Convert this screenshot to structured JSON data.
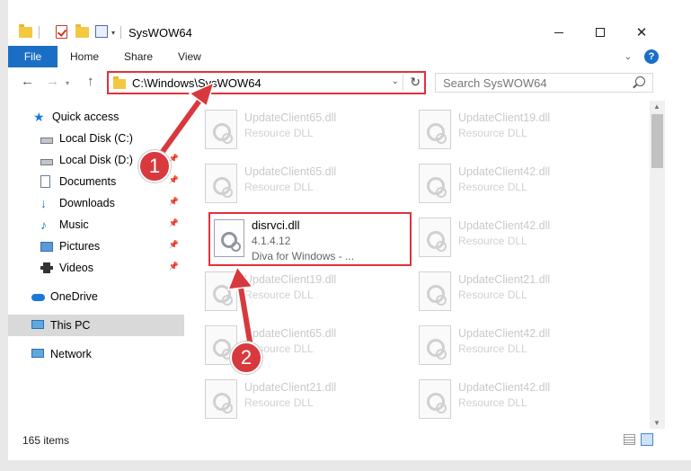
{
  "window": {
    "title": "SysWOW64",
    "controls": {
      "minimize": "minimize",
      "maximize": "maximize",
      "close": "✕"
    }
  },
  "ribbon": {
    "tabs": [
      "File",
      "Home",
      "Share",
      "View"
    ],
    "help": "?"
  },
  "nav": {
    "address": "C:\\Windows\\SysWOW64",
    "search_placeholder": "Search SysWOW64"
  },
  "sidebar": {
    "items": [
      {
        "label": "Quick access",
        "icon": "star-icon"
      },
      {
        "label": "Local Disk (C:)",
        "icon": "disk-icon",
        "pinned": true
      },
      {
        "label": "Local Disk (D:)",
        "icon": "disk-icon",
        "pinned": true
      },
      {
        "label": "Documents",
        "icon": "documents-icon",
        "pinned": true
      },
      {
        "label": "Downloads",
        "icon": "download-icon",
        "pinned": true
      },
      {
        "label": "Music",
        "icon": "music-icon",
        "pinned": true
      },
      {
        "label": "Pictures",
        "icon": "pictures-icon",
        "pinned": true
      },
      {
        "label": "Videos",
        "icon": "videos-icon",
        "pinned": true
      },
      {
        "label": "OneDrive",
        "icon": "onedrive-icon"
      },
      {
        "label": "This PC",
        "icon": "pc-icon",
        "selected": true
      },
      {
        "label": "Network",
        "icon": "network-icon"
      }
    ]
  },
  "files": {
    "left": [
      {
        "name": "UpdateClient65.dll",
        "type": "Resource DLL"
      },
      {
        "name": "UpdateClient65.dll",
        "type": "Resource DLL"
      },
      {
        "name": "UpdateClient19.dll",
        "type": "Resource DLL"
      },
      {
        "name": "UpdateClient65.dll",
        "type": "Resource DLL"
      },
      {
        "name": "UpdateClient21.dll",
        "type": "Resource DLL"
      }
    ],
    "right": [
      {
        "name": "UpdateClient19.dll",
        "type": "Resource DLL"
      },
      {
        "name": "UpdateClient42.dll",
        "type": "Resource DLL"
      },
      {
        "name": "UpdateClient42.dll",
        "type": "Resource DLL"
      },
      {
        "name": "UpdateClient21.dll",
        "type": "Resource DLL"
      },
      {
        "name": "UpdateClient42.dll",
        "type": "Resource DLL"
      },
      {
        "name": "UpdateClient42.dll",
        "type": "Resource DLL"
      }
    ],
    "highlighted": {
      "name": "disrvci.dll",
      "version": "4.1.4.12",
      "description": "Diva for Windows - ..."
    }
  },
  "status": {
    "count": "165 items"
  },
  "annotations": {
    "marker_1": "1",
    "marker_2": "2"
  },
  "colors": {
    "accent": "#1a6fc4",
    "highlight_border": "#e0323a",
    "marker": "#d8393e"
  }
}
